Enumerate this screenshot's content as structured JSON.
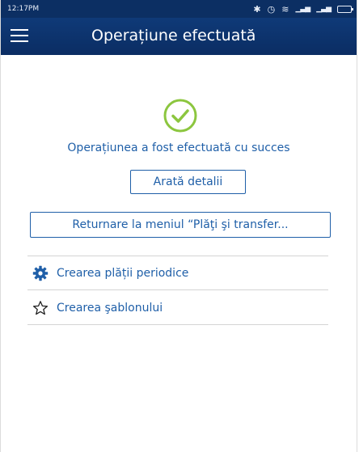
{
  "status_bar": {
    "time": "12:17PM",
    "icons": [
      "bluetooth-icon",
      "alarm-icon",
      "wifi-icon",
      "signal-icon",
      "signal-icon",
      "battery-icon"
    ]
  },
  "app_bar": {
    "title": "Operațiune efectuată",
    "menu_icon": "hamburger-menu-icon"
  },
  "colors": {
    "header": "#0c2f63",
    "accent": "#1f5fa8",
    "success": "#8cc63f"
  },
  "main": {
    "success_icon": "check-circle-icon",
    "message": "Operațiunea a fost efectuată cu succes",
    "details_button": "Arată detalii",
    "return_button": "Returnare la meniul “Plăţi şi transfer..."
  },
  "actions": [
    {
      "icon": "gear-icon",
      "label": "Crearea plății periodice"
    },
    {
      "icon": "star-outline-icon",
      "label": "Crearea şablonului"
    }
  ]
}
